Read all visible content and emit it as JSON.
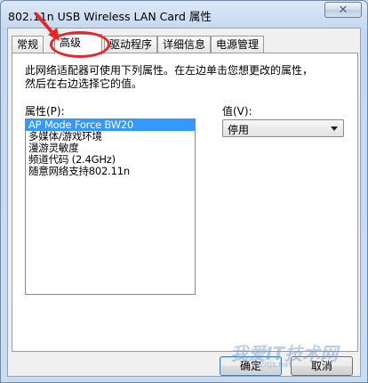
{
  "window": {
    "title": "802.11n USB Wireless LAN Card 属性",
    "close_glyph": "✕"
  },
  "tabs": [
    {
      "label": "常规"
    },
    {
      "label": "高级"
    },
    {
      "label": "驱动程序"
    },
    {
      "label": "详细信息"
    },
    {
      "label": "电源管理"
    }
  ],
  "active_tab": "高级",
  "advanced": {
    "description_line1": "此网络适配器可使用下列属性。在左边单击您想更改的属性，",
    "description_line2": "然后在右边选择它的值。",
    "property_label": "属性(P):",
    "value_label": "值(V):",
    "properties": [
      "AP Mode Force BW20",
      "多媒体/游戏环境",
      "漫游灵敏度",
      "频道代码 (2.4GHz)",
      "随意网络支持802.11n"
    ],
    "selected_property": "AP Mode Force BW20",
    "value_selected": "停用"
  },
  "buttons": {
    "ok": "确定",
    "cancel": "取消"
  },
  "watermark": {
    "text": "我爱IT技术网",
    "sub": "52itjs.net"
  },
  "colors": {
    "selection": "#3399ff",
    "annotation": "#e8262a"
  }
}
